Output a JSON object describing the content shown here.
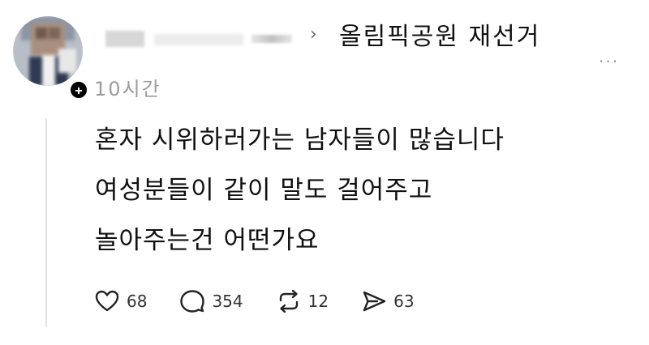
{
  "post": {
    "community": "올림픽공원 재선거",
    "time": "10시간",
    "body": "혼자 시위하러가는 남자들이 많습니다\n여성분들이 같이 말도 걸어주고\n놀아주는건 어떤가요",
    "more_label": "···",
    "chevron": "›"
  },
  "actions": {
    "likes": "68",
    "comments": "354",
    "reposts": "12",
    "shares": "63"
  },
  "icons": {
    "like": "heart-icon",
    "comment": "speech-bubble-icon",
    "repost": "repost-icon",
    "share": "send-icon",
    "more": "more-dots-icon",
    "follow": "plus-icon"
  }
}
